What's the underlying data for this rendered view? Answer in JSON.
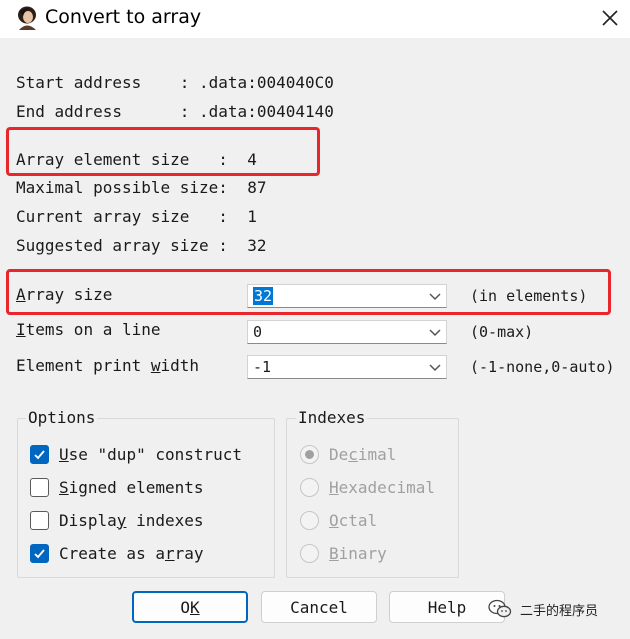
{
  "window": {
    "title": "Convert to array",
    "app_icon": "ida-lady-icon",
    "close_icon": "close-icon"
  },
  "info": {
    "start_address": "Start address    : .data:004040C0",
    "end_address": "End address      : .data:00404140",
    "element_size": "Array element size   :  4",
    "maximal_size": "Maximal possible size:  87",
    "current_size": "Current array size   :  1",
    "suggested_size": "Suggested array size :  32"
  },
  "fields": {
    "array_size": {
      "label_pre": "",
      "label_u": "A",
      "label_post": "rray size",
      "value": "32",
      "hint": "(in elements)"
    },
    "items_on_line": {
      "label_pre": "",
      "label_u": "I",
      "label_post": "tems on a line",
      "value": "0",
      "hint": "(0-max)"
    },
    "print_width": {
      "label_pre": "Element print ",
      "label_u": "w",
      "label_post": "idth",
      "value": "-1",
      "hint": "(-1-none,0-auto)"
    }
  },
  "options": {
    "title": "Options",
    "items": [
      {
        "pre": "",
        "u": "U",
        "post": "se \"dup\" construct",
        "checked": true
      },
      {
        "pre": "",
        "u": "S",
        "post": "igned elements",
        "checked": false
      },
      {
        "pre": "Displa",
        "u": "y",
        "post": " indexes",
        "checked": false
      },
      {
        "pre": "Create as a",
        "u": "r",
        "post": "ray",
        "checked": true
      }
    ]
  },
  "indexes": {
    "title": "Indexes",
    "items": [
      {
        "pre": "De",
        "u": "c",
        "post": "imal",
        "selected": true
      },
      {
        "pre": "",
        "u": "H",
        "post": "exadecimal",
        "selected": false
      },
      {
        "pre": "",
        "u": "O",
        "post": "ctal",
        "selected": false
      },
      {
        "pre": "",
        "u": "B",
        "post": "inary",
        "selected": false
      }
    ]
  },
  "buttons": {
    "ok": {
      "pre": "O",
      "u": "K",
      "post": ""
    },
    "cancel": "Cancel",
    "help": "Help"
  },
  "watermark": {
    "text": "二手的程序员",
    "icon": "wechat-icon"
  },
  "colors": {
    "highlight_box": "#e8262b",
    "accent": "#0067c0"
  }
}
